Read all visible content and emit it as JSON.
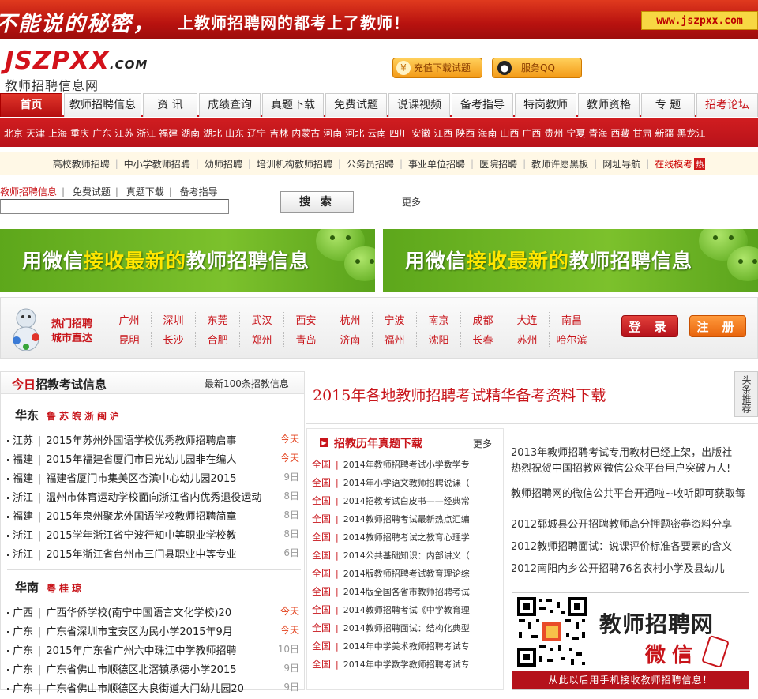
{
  "banner": {
    "slogan_left": "不能说的秘密，",
    "slogan_right": "上教师招聘网的都考上了教师！",
    "url": "www.jszpxx.com"
  },
  "logo": {
    "mark": "JSZPXX",
    "dotcom": ".COM",
    "subtitle": "教师招聘信息网"
  },
  "header_buttons": {
    "recharge": "充值下载试题",
    "qq": "服务QQ"
  },
  "nav": {
    "tabs": [
      "首页",
      "教师招聘信息",
      "资 讯",
      "成绩查询",
      "真题下载",
      "免费试题",
      "说课视频",
      "备考指导",
      "特岗教师",
      "教师资格",
      "专 题",
      "招考论坛"
    ]
  },
  "provinces": [
    "北京",
    "天津",
    "上海",
    "重庆",
    "广东",
    "江苏",
    "浙江",
    "福建",
    "湖南",
    "湖北",
    "山东",
    "辽宁",
    "吉林",
    "内蒙古",
    "河南",
    "河北",
    "云南",
    "四川",
    "安徽",
    "江西",
    "陕西",
    "海南",
    "山西",
    "广西",
    "贵州",
    "宁夏",
    "青海",
    "西藏",
    "甘肃",
    "新疆",
    "黑龙江"
  ],
  "subnav": {
    "items": [
      "高校教师招聘",
      "中小学教师招聘",
      "幼师招聘",
      "培训机构教师招聘",
      "公务员招聘",
      "事业单位招聘",
      "医院招聘",
      "教师许愿黑板",
      "网址导航"
    ],
    "highlight": "在线模考",
    "hot_badge": "热"
  },
  "search": {
    "categories": [
      "教师招聘信息",
      "免费试题",
      "真题下载",
      "备考指导"
    ],
    "input_value": "",
    "button": "搜 索",
    "more": "更多"
  },
  "wechat_banner": {
    "prefix": "用微信",
    "highlight": "接收最新的",
    "suffix": "教师招聘信息"
  },
  "hotcity": {
    "label_line1": "热门招聘",
    "label_line2": "城市直达",
    "row1": [
      "广州",
      "深圳",
      "东莞",
      "武汉",
      "西安",
      "杭州",
      "宁波",
      "南京",
      "成都",
      "大连",
      "南昌"
    ],
    "row2": [
      "昆明",
      "长沙",
      "合肥",
      "郑州",
      "青岛",
      "济南",
      "福州",
      "沈阳",
      "长春",
      "苏州",
      "哈尔滨"
    ],
    "login": "登 录",
    "register": "注 册"
  },
  "left": {
    "title_red": "今日",
    "title_rest": "招教考试信息",
    "more": "最新100条招教信息",
    "east": {
      "name": "华东",
      "subs": "鲁苏皖浙闽沪",
      "jobs": [
        {
          "prov": "江苏",
          "title": "2015年苏州外国语学校优秀教师招聘启事",
          "date": "今天"
        },
        {
          "prov": "福建",
          "title": "2015年福建省厦门市日光幼儿园非在编人",
          "date": "今天"
        },
        {
          "prov": "福建",
          "title": "福建省厦门市集美区杏滨中心幼儿园2015",
          "date": "9日"
        },
        {
          "prov": "浙江",
          "title": "温州市体育运动学校面向浙江省内优秀退役运动",
          "date": "8日"
        },
        {
          "prov": "福建",
          "title": "2015年泉州聚龙外国语学校教师招聘简章",
          "date": "8日"
        },
        {
          "prov": "浙江",
          "title": "2015学年浙江省宁波行知中等职业学校教",
          "date": "8日"
        },
        {
          "prov": "浙江",
          "title": "2015年浙江省台州市三门县职业中等专业",
          "date": "6日"
        }
      ]
    },
    "south": {
      "name": "华南",
      "subs": "粤桂琼",
      "jobs": [
        {
          "prov": "广西",
          "title": "广西华侨学校(南宁中国语言文化学校)20",
          "date": "今天"
        },
        {
          "prov": "广东",
          "title": "广东省深圳市宝安区为民小学2015年9月",
          "date": "今天"
        },
        {
          "prov": "广东",
          "title": "2015年广东省广州六中珠江中学教师招聘",
          "date": "10日"
        },
        {
          "prov": "广东",
          "title": "广东省佛山市顺德区北滘镇承德小学2015",
          "date": "9日"
        },
        {
          "prov": "广东",
          "title": "广东省佛山市顺德区大良街道大门幼儿园20",
          "date": "9日"
        }
      ]
    }
  },
  "right": {
    "headline": "2015年各地教师招聘考试精华备考资料下载",
    "side_tab": "头条推荐",
    "exam_title": "招教历年真题下载",
    "exam_more": "更多",
    "exam_region": "全国",
    "exam_items": [
      "2014年教师招聘考试小学数学专",
      "2014年小学语文教师招聘说课（",
      "2014招教考试白皮书——经典常",
      "2014教师招聘考试最新热点汇编",
      "2014教师招聘考试之教育心理学",
      "2014公共基础知识：内部讲义（",
      "2014版教师招聘考试教育理论综",
      "2014版全国各省市教师招聘考试",
      "2014教师招聘考试《中学教育理",
      "2014教师招聘面试：结构化典型",
      "2014年中学美术教师招聘考试专",
      "2014年中学数学教师招聘考试专"
    ],
    "news": [
      "2013年教师招聘考试专用教材已经上架，出版社",
      "热烈祝贺中国招教网微信公众平台用户突破万人!",
      "教师招聘网的微信公共平台开通啦~收听即可获取每",
      "2012郓城县公开招聘教师高分押题密卷资料分享",
      "2012教师招聘面试：说课评价标准各要素的含义",
      "2012南阳内乡公开招聘76名农村小学及县幼儿"
    ],
    "qr_title": "教师招聘网",
    "qr_sub": "微信",
    "qr_foot": "从此以后用手机接收教师招聘信息！"
  }
}
